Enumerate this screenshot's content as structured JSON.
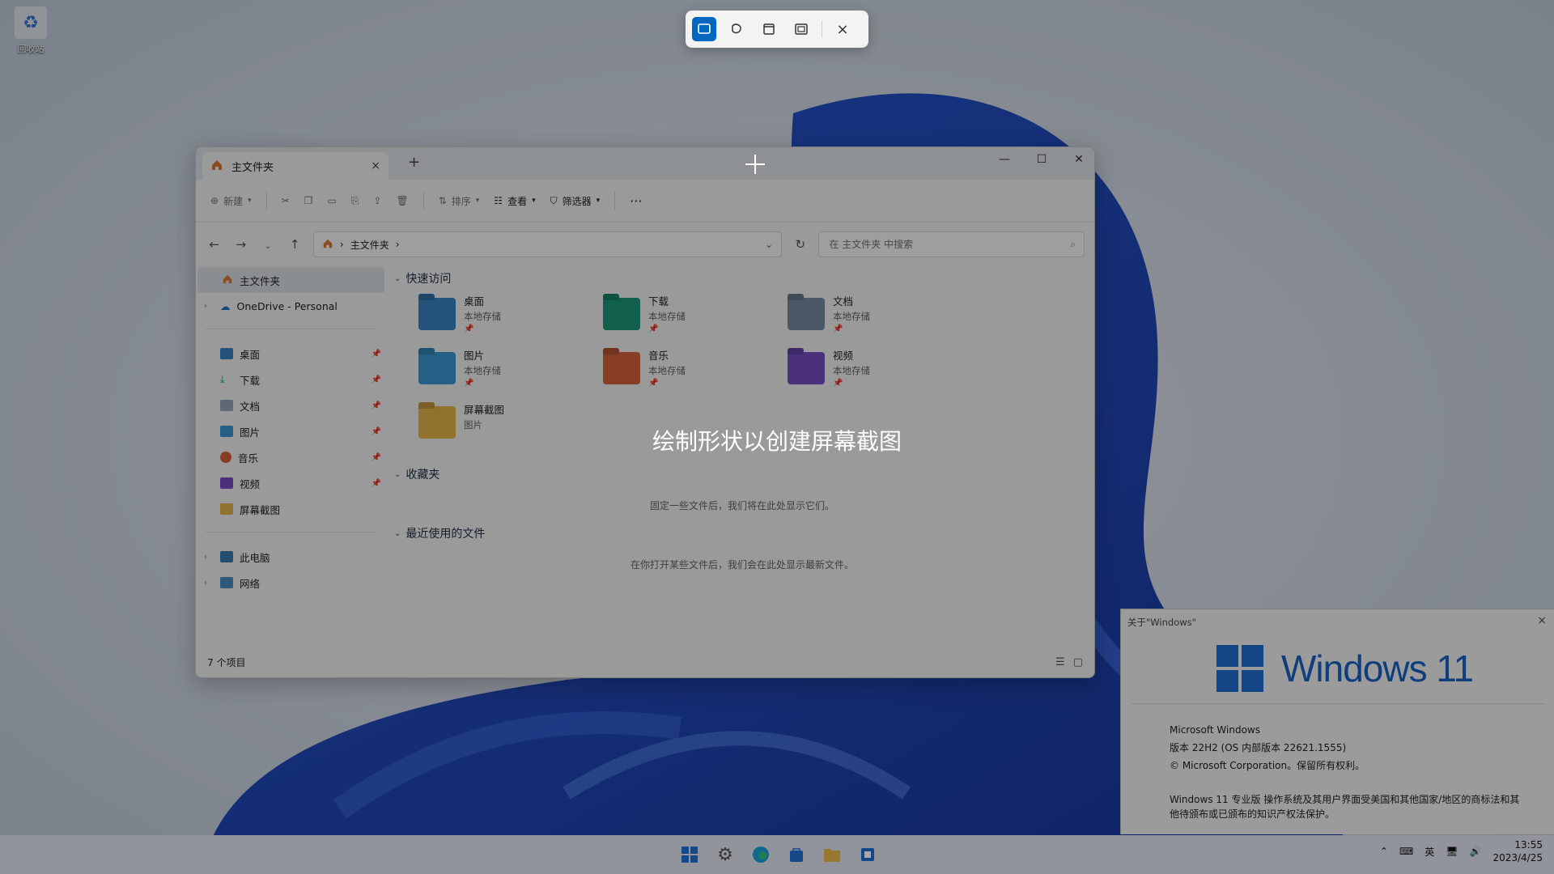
{
  "desktop": {
    "recycle_bin_label": "回收站"
  },
  "snip": {
    "hint": "绘制形状以创建屏幕截图",
    "close_glyph": "×"
  },
  "explorer": {
    "tab_title": "主文件夹",
    "tab_close": "×",
    "new_tab": "+",
    "window_controls": {
      "minimize": "—",
      "maximize": "☐",
      "close": "✕"
    },
    "command_bar": {
      "new": "新建",
      "sort": "排序",
      "view": "查看",
      "filter": "筛选器",
      "more": "···"
    },
    "address": {
      "current": "主文件夹",
      "separator": "›"
    },
    "search": {
      "placeholder": "在 主文件夹 中搜索"
    },
    "sidebar": {
      "home": "主文件夹",
      "onedrive": "OneDrive - Personal",
      "pinned": [
        "桌面",
        "下载",
        "文档",
        "图片",
        "音乐",
        "视频"
      ],
      "screenshots": "屏幕截图",
      "this_pc": "此电脑",
      "network": "网络"
    },
    "quick_access": {
      "title": "快速访问",
      "items": [
        {
          "name": "桌面",
          "sub": "本地存储",
          "color": "#3a86c8"
        },
        {
          "name": "下载",
          "sub": "本地存储",
          "color": "#1a9c7a"
        },
        {
          "name": "文档",
          "sub": "本地存储",
          "color": "#7a8fa8"
        },
        {
          "name": "图片",
          "sub": "本地存储",
          "color": "#3a9ad9"
        },
        {
          "name": "音乐",
          "sub": "本地存储",
          "color": "#d9633a"
        },
        {
          "name": "视频",
          "sub": "本地存储",
          "color": "#7a4fc8"
        },
        {
          "name": "屏幕截图",
          "sub": "图片",
          "color": "#e8b84a"
        }
      ]
    },
    "favorites": {
      "title": "收藏夹",
      "empty": "固定一些文件后，我们将在此处显示它们。"
    },
    "recent": {
      "title": "最近使用的文件",
      "empty": "在你打开某些文件后，我们会在此处显示最新文件。"
    },
    "status": "7 个项目"
  },
  "about": {
    "title": "关于\"Windows\"",
    "logo_text": "Windows 11",
    "line1": "Microsoft Windows",
    "line2": "版本 22H2 (OS 内部版本 22621.1555)",
    "line3": "© Microsoft Corporation。保留所有权利。",
    "legal": "Windows 11 专业版 操作系统及其用户界面受美国和其他国家/地区的商标法和其他待颁布或已颁布的知识产权法保护。"
  },
  "taskbar": {
    "ime": "英",
    "time": "13:55",
    "date": "2023/4/25"
  },
  "colors": {
    "accent": "#0067c0",
    "win_blue": "#1f6fd6"
  }
}
